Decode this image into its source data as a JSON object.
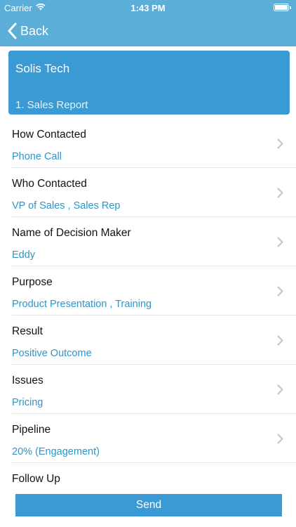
{
  "status_bar": {
    "carrier": "Carrier",
    "time": "1:43 PM"
  },
  "nav": {
    "back_label": "Back"
  },
  "header": {
    "company": "Solis Tech",
    "report": "1. Sales Report"
  },
  "rows": [
    {
      "title": "How Contacted",
      "value": "Phone Call"
    },
    {
      "title": "Who Contacted",
      "value": "VP of Sales , Sales Rep"
    },
    {
      "title": "Name of Decision Maker",
      "value": "Eddy"
    },
    {
      "title": "Purpose",
      "value": "Product Presentation , Training"
    },
    {
      "title": "Result",
      "value": "Positive Outcome"
    },
    {
      "title": "Issues",
      "value": "Pricing"
    },
    {
      "title": "Pipeline",
      "value": "20% (Engagement)"
    },
    {
      "title": "Follow Up",
      "value": ""
    }
  ],
  "send_label": "Send",
  "colors": {
    "nav_bar": "#5aaed7",
    "header_card": "#3a9ad4",
    "value_text": "#2f95c7",
    "send_button": "#3a9ad4"
  },
  "icons": {
    "back": "chevron-left-icon",
    "row": "chevron-right-icon",
    "wifi": "wifi-icon",
    "battery": "battery-icon"
  }
}
